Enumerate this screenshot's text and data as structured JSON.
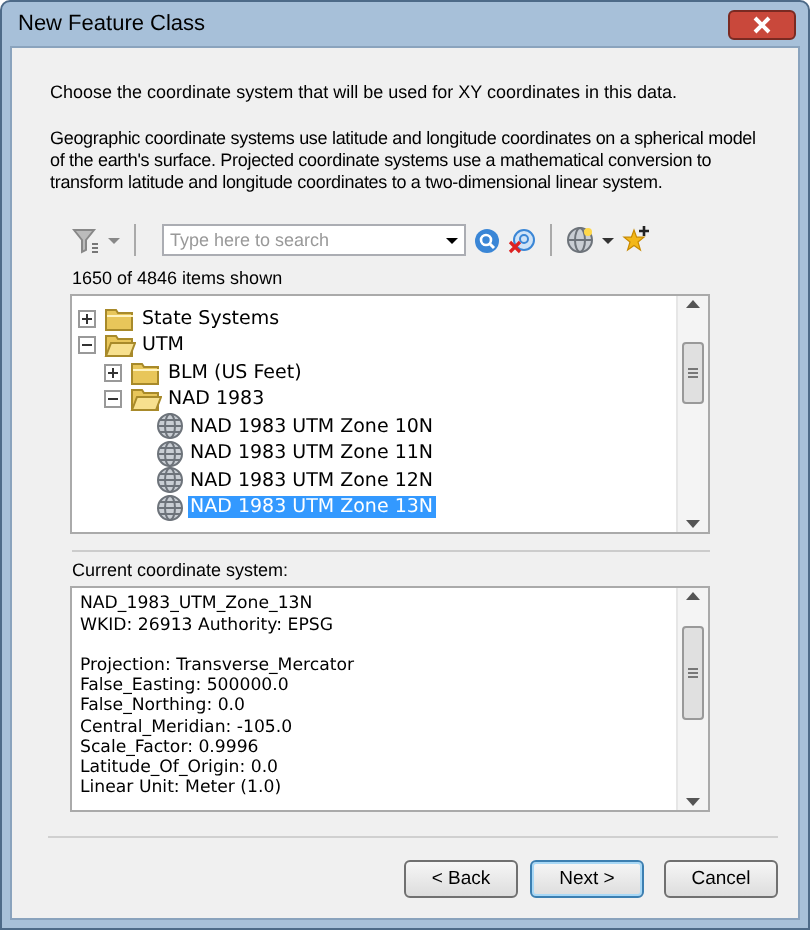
{
  "window": {
    "title": "New Feature Class"
  },
  "instruction": "Choose the coordinate system that will be used for XY coordinates in this data.",
  "description": "Geographic coordinate systems use latitude and longitude coordinates on a spherical model of the earth's surface. Projected coordinate systems use a mathematical conversion to transform latitude and longitude coordinates to a two-dimensional linear system.",
  "search": {
    "placeholder": "Type here to search"
  },
  "items_shown": "1650 of 4846 items shown",
  "tree": [
    {
      "label": "State Systems",
      "kind": "folder",
      "expanded": false,
      "selected": false
    },
    {
      "label": "UTM",
      "kind": "folder",
      "expanded": true,
      "selected": false,
      "children": [
        {
          "label": "BLM (US Feet)",
          "kind": "folder",
          "expanded": false,
          "selected": false
        },
        {
          "label": "NAD 1983",
          "kind": "folder",
          "expanded": true,
          "selected": false,
          "children": [
            {
              "label": "NAD 1983 UTM Zone 10N",
              "kind": "system",
              "selected": false
            },
            {
              "label": "NAD 1983 UTM Zone 11N",
              "kind": "system",
              "selected": false
            },
            {
              "label": "NAD 1983 UTM Zone 12N",
              "kind": "system",
              "selected": false
            },
            {
              "label": "NAD 1983 UTM Zone 13N",
              "kind": "system",
              "selected": true
            }
          ]
        }
      ]
    }
  ],
  "current": {
    "label": "Current coordinate system:",
    "blocks": [
      [
        "NAD_1983_UTM_Zone_13N",
        "WKID: 26913 Authority: EPSG"
      ],
      [
        "Projection: Transverse_Mercator",
        "False_Easting: 500000.0",
        "False_Northing: 0.0",
        "Central_Meridian: -105.0",
        "Scale_Factor: 0.9996",
        "Latitude_Of_Origin: 0.0",
        "Linear Unit: Meter (1.0)"
      ]
    ]
  },
  "buttons": [
    {
      "label": "< Back",
      "default": false
    },
    {
      "label": "Next >",
      "default": true
    },
    {
      "label": "Cancel",
      "default": false
    }
  ]
}
